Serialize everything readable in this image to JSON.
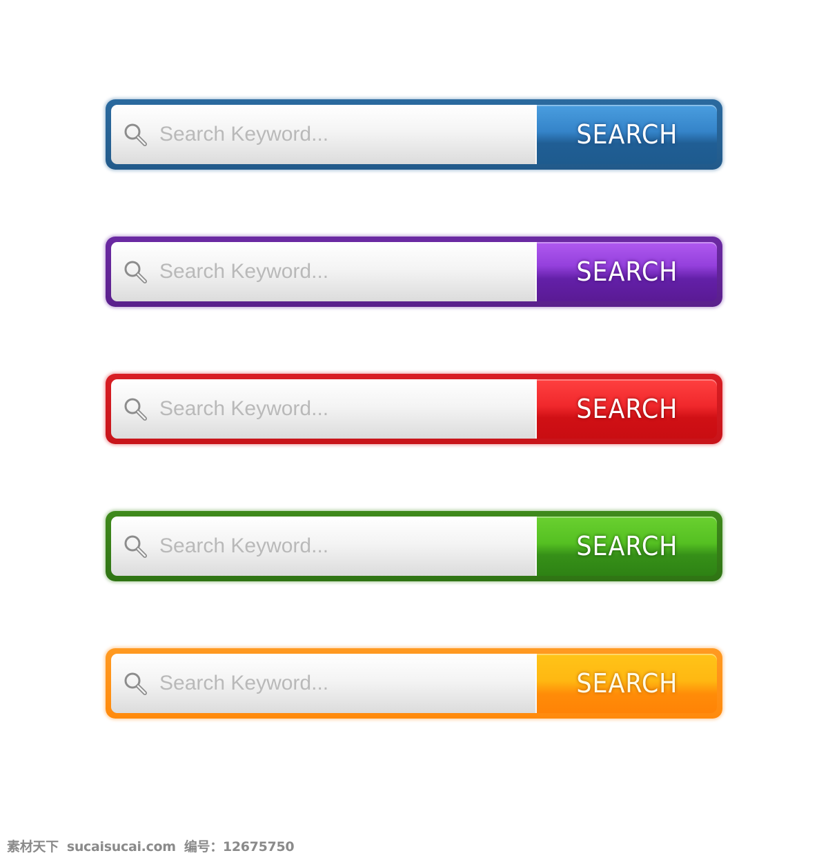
{
  "search_bars": [
    {
      "id": "blue",
      "color": "#2b6a9f",
      "placeholder": "Search Keyword...",
      "value": "",
      "button_label": "SEARCH",
      "icon": "search-icon"
    },
    {
      "id": "purple",
      "color": "#6b2aa3",
      "placeholder": "Search Keyword...",
      "value": "",
      "button_label": "SEARCH",
      "icon": "search-icon"
    },
    {
      "id": "red",
      "color": "#d81e24",
      "placeholder": "Search Keyword...",
      "value": "",
      "button_label": "SEARCH",
      "icon": "search-icon"
    },
    {
      "id": "green",
      "color": "#3f8a1c",
      "placeholder": "Search Keyword...",
      "value": "",
      "button_label": "SEARCH",
      "icon": "search-icon"
    },
    {
      "id": "orange",
      "color": "#ff8a0c",
      "placeholder": "Search Keyword...",
      "value": "",
      "button_label": "SEARCH",
      "icon": "search-icon"
    }
  ],
  "watermark": {
    "site_name": "素材天下",
    "domain": "sucaisucai.com",
    "id_label": "编号：",
    "id_value": "12675750"
  }
}
